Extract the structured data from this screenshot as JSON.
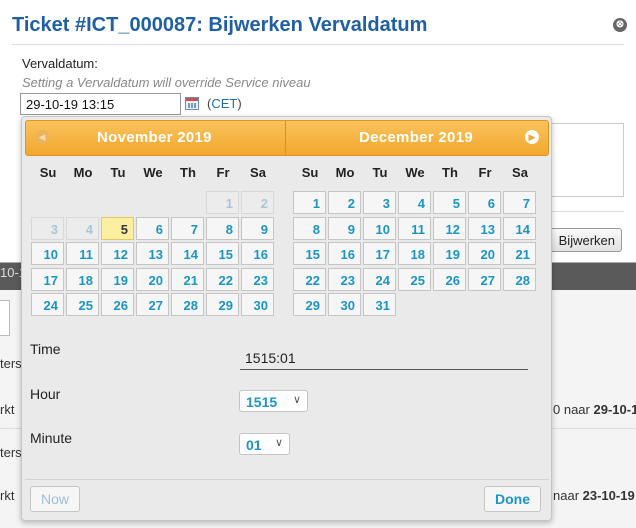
{
  "dialog": {
    "title": "Ticket #ICT_000087: Bijwerken Vervaldatum",
    "close_glyph": "⊗",
    "field_label": "Vervaldatum:",
    "hint": "Setting a Vervaldatum will override Service niveau",
    "date_value": "29-10-19 13:15",
    "tz_open": "(",
    "tz_code": "CET",
    "tz_close": ")",
    "update_button": "Bijwerken"
  },
  "background": {
    "snip1": "10-1",
    "snip2": "ters",
    "snip3": "rkt",
    "snip4_pre": "0 naar ",
    "snip4_bold": "29-10-1",
    "snip5": "ters",
    "snip6": "rkt",
    "snip7_pre": "naar ",
    "snip7_bold": "23-10-19"
  },
  "datepicker": {
    "prev_icon": "◀",
    "next_icon": "▶",
    "months": [
      {
        "title": "November 2019",
        "weekdays": [
          "Su",
          "Mo",
          "Tu",
          "We",
          "Th",
          "Fr",
          "Sa"
        ],
        "weeks": [
          [
            {
              "d": "",
              "t": ""
            },
            {
              "d": "",
              "t": ""
            },
            {
              "d": "",
              "t": ""
            },
            {
              "d": "",
              "t": ""
            },
            {
              "d": "",
              "t": ""
            },
            {
              "d": "1",
              "t": "other"
            },
            {
              "d": "2",
              "t": "other"
            }
          ],
          [
            {
              "d": "3",
              "t": "other"
            },
            {
              "d": "4",
              "t": "other"
            },
            {
              "d": "5",
              "t": "today"
            },
            {
              "d": "6",
              "t": ""
            },
            {
              "d": "7",
              "t": ""
            },
            {
              "d": "8",
              "t": ""
            },
            {
              "d": "9",
              "t": ""
            }
          ],
          [
            {
              "d": "10",
              "t": ""
            },
            {
              "d": "11",
              "t": ""
            },
            {
              "d": "12",
              "t": ""
            },
            {
              "d": "13",
              "t": ""
            },
            {
              "d": "14",
              "t": ""
            },
            {
              "d": "15",
              "t": ""
            },
            {
              "d": "16",
              "t": ""
            }
          ],
          [
            {
              "d": "17",
              "t": ""
            },
            {
              "d": "18",
              "t": ""
            },
            {
              "d": "19",
              "t": ""
            },
            {
              "d": "20",
              "t": ""
            },
            {
              "d": "21",
              "t": ""
            },
            {
              "d": "22",
              "t": ""
            },
            {
              "d": "23",
              "t": ""
            }
          ],
          [
            {
              "d": "24",
              "t": ""
            },
            {
              "d": "25",
              "t": ""
            },
            {
              "d": "26",
              "t": ""
            },
            {
              "d": "27",
              "t": ""
            },
            {
              "d": "28",
              "t": ""
            },
            {
              "d": "29",
              "t": ""
            },
            {
              "d": "30",
              "t": ""
            }
          ]
        ]
      },
      {
        "title": "December 2019",
        "weekdays": [
          "Su",
          "Mo",
          "Tu",
          "We",
          "Th",
          "Fr",
          "Sa"
        ],
        "weeks": [
          [
            {
              "d": "1",
              "t": ""
            },
            {
              "d": "2",
              "t": ""
            },
            {
              "d": "3",
              "t": ""
            },
            {
              "d": "4",
              "t": ""
            },
            {
              "d": "5",
              "t": ""
            },
            {
              "d": "6",
              "t": ""
            },
            {
              "d": "7",
              "t": ""
            }
          ],
          [
            {
              "d": "8",
              "t": ""
            },
            {
              "d": "9",
              "t": ""
            },
            {
              "d": "10",
              "t": ""
            },
            {
              "d": "11",
              "t": ""
            },
            {
              "d": "12",
              "t": ""
            },
            {
              "d": "13",
              "t": ""
            },
            {
              "d": "14",
              "t": ""
            }
          ],
          [
            {
              "d": "15",
              "t": ""
            },
            {
              "d": "16",
              "t": ""
            },
            {
              "d": "17",
              "t": ""
            },
            {
              "d": "18",
              "t": ""
            },
            {
              "d": "19",
              "t": ""
            },
            {
              "d": "20",
              "t": ""
            },
            {
              "d": "21",
              "t": ""
            }
          ],
          [
            {
              "d": "22",
              "t": ""
            },
            {
              "d": "23",
              "t": ""
            },
            {
              "d": "24",
              "t": ""
            },
            {
              "d": "25",
              "t": ""
            },
            {
              "d": "26",
              "t": ""
            },
            {
              "d": "27",
              "t": ""
            },
            {
              "d": "28",
              "t": ""
            }
          ],
          [
            {
              "d": "29",
              "t": ""
            },
            {
              "d": "30",
              "t": ""
            },
            {
              "d": "31",
              "t": ""
            },
            {
              "d": "",
              "t": ""
            },
            {
              "d": "",
              "t": ""
            },
            {
              "d": "",
              "t": ""
            },
            {
              "d": "",
              "t": ""
            }
          ]
        ]
      }
    ],
    "time_label": "Time",
    "time_value": "1515:01",
    "hour_label": "Hour",
    "hour_value": "1515",
    "minute_label": "Minute",
    "minute_value": "01",
    "chevron_glyph": "∨",
    "now_button": "Now",
    "done_button": "Done"
  }
}
